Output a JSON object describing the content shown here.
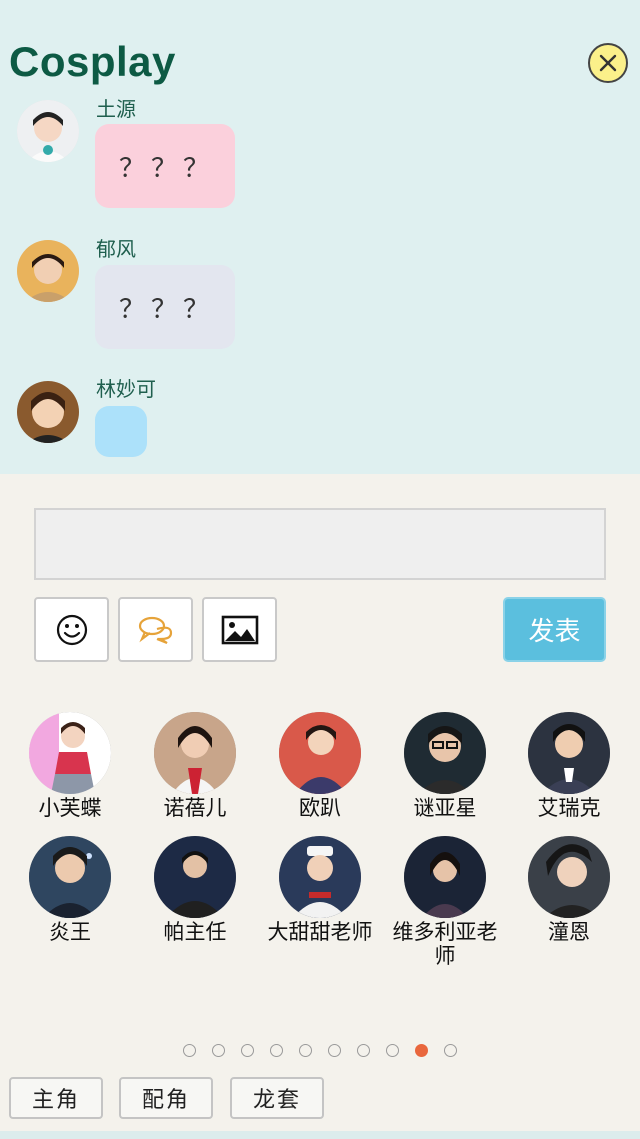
{
  "app": {
    "title": "Cosplay"
  },
  "messages": [
    {
      "name": "土源",
      "text": "？？？",
      "bubble_color": "#fbd0dc"
    },
    {
      "name": "郁风",
      "text": "？？？",
      "bubble_color": "#e3e6ef"
    },
    {
      "name": "林妙可",
      "text": "",
      "bubble_color": "#ace1fa"
    }
  ],
  "composer": {
    "input_value": "",
    "tools": [
      "smiley-icon",
      "speech-bubbles-icon",
      "image-icon"
    ],
    "send_label": "发表"
  },
  "characters": [
    {
      "name": "小芙蝶"
    },
    {
      "name": "诺蓓儿"
    },
    {
      "name": "欧趴"
    },
    {
      "name": "谜亚星"
    },
    {
      "name": "艾瑞克"
    },
    {
      "name": "炎王"
    },
    {
      "name": "帕主任"
    },
    {
      "name": "大甜甜老师"
    },
    {
      "name": "维多利亚老师"
    },
    {
      "name": "潼恩"
    }
  ],
  "pagination": {
    "total": 10,
    "current": 9
  },
  "categories": [
    "主角",
    "配角",
    "龙套"
  ],
  "colors": {
    "accent": "#5bbfde",
    "title": "#0d5a44",
    "active_dot": "#e9673d"
  }
}
